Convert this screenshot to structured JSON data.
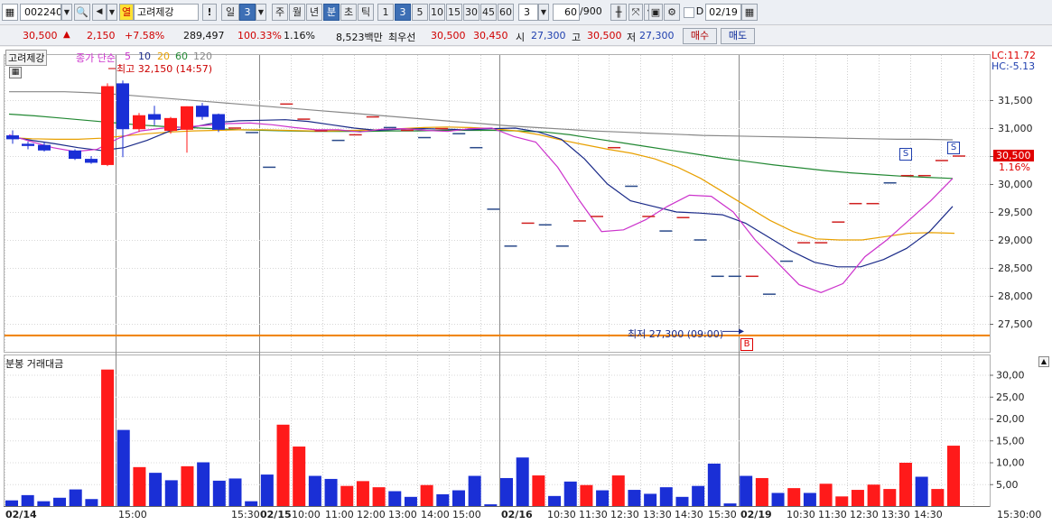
{
  "toolbar": {
    "code": "002240",
    "name": "고려제강",
    "exclaim": "!",
    "day_label": "일",
    "day_count": "3",
    "periods": [
      "주",
      "월",
      "년",
      "분",
      "초",
      "틱"
    ],
    "minutes": [
      "1",
      "3",
      "5",
      "10",
      "15",
      "30",
      "45",
      "60"
    ],
    "interval": "3",
    "count": "60",
    "total": "/900",
    "check_label": "D",
    "date": "02/19"
  },
  "quote": {
    "price": "30,500",
    "change": "2,150",
    "change_pct": "+7.58%",
    "volume": "289,497",
    "vol_ratio": "100.33%",
    "turnover": "1.16%",
    "amount": "8,523백만",
    "best_label": "최우선",
    "ask": "30,500",
    "bid": "30,450",
    "open_label": "시",
    "open": "27,300",
    "high_label": "고",
    "high": "30,500",
    "low_label": "저",
    "low": "27,300",
    "buy_button": "매수",
    "sell_button": "매도"
  },
  "legend": {
    "stock": "고려제강",
    "type": "종가 단순",
    "ma": [
      "5",
      "10",
      "20",
      "60",
      "120"
    ],
    "ma_colors": [
      "#cc33cc",
      "#1a2a88",
      "#e8a000",
      "#228833",
      "#888888"
    ],
    "high_marker": "최고 32,150 (14:57)",
    "low_marker": "최저 27,300 (09:00)",
    "lc": "LC:11.72",
    "hc": "HC:-5.13",
    "price_tag": "30,500",
    "pct_tag": "1.16%",
    "signal_s": "S",
    "signal_b": "B"
  },
  "lower_title": "분봉 거래대금",
  "chart_data": [
    {
      "type": "candlestick",
      "y_ticks": [
        "31,500",
        "31,000",
        "30,500",
        "30,000",
        "29,500",
        "29,000",
        "28,500",
        "28,000",
        "27,500"
      ],
      "candles": [
        {
          "open": 30870,
          "high": 30960,
          "low": 30720,
          "close": 30800,
          "color": "blue"
        },
        {
          "open": 30720,
          "high": 30760,
          "low": 30620,
          "close": 30680,
          "color": "blue"
        },
        {
          "open": 30700,
          "high": 30760,
          "low": 30580,
          "close": 30600,
          "color": "blue"
        },
        {
          "open": 30600,
          "high": 30620,
          "low": 30430,
          "close": 30450,
          "color": "blue"
        },
        {
          "open": 30450,
          "high": 30500,
          "low": 30360,
          "close": 30380,
          "color": "blue"
        },
        {
          "open": 30340,
          "high": 31800,
          "low": 30320,
          "close": 31750,
          "color": "red"
        },
        {
          "open": 31800,
          "high": 31850,
          "low": 30480,
          "close": 30980,
          "color": "blue"
        },
        {
          "open": 30980,
          "high": 31270,
          "low": 30930,
          "close": 31230,
          "color": "red"
        },
        {
          "open": 31250,
          "high": 31400,
          "low": 31050,
          "close": 31150,
          "color": "blue"
        },
        {
          "open": 30950,
          "high": 31200,
          "low": 30900,
          "close": 31180,
          "color": "red"
        },
        {
          "open": 30970,
          "high": 31390,
          "low": 30560,
          "close": 31390,
          "color": "red"
        },
        {
          "open": 31400,
          "high": 31450,
          "low": 31150,
          "close": 31200,
          "color": "blue"
        },
        {
          "open": 31250,
          "high": 31260,
          "low": 30930,
          "close": 30970,
          "color": "blue"
        }
      ],
      "flat_marks": [
        {
          "price": 31000,
          "color": "red"
        },
        {
          "price": 30920,
          "color": "blue"
        },
        {
          "price": 30300,
          "color": "blue"
        },
        {
          "price": 31430,
          "color": "red"
        },
        {
          "price": 31160,
          "color": "red"
        },
        {
          "price": 30950,
          "color": "red"
        },
        {
          "price": 30780,
          "color": "blue"
        },
        {
          "price": 30880,
          "color": "red"
        },
        {
          "price": 31200,
          "color": "red"
        },
        {
          "price": 31010,
          "color": "blue"
        },
        {
          "price": 30960,
          "color": "red"
        },
        {
          "price": 30830,
          "color": "blue"
        },
        {
          "price": 30990,
          "color": "red"
        },
        {
          "price": 30900,
          "color": "blue"
        },
        {
          "price": 30650,
          "color": "blue"
        },
        {
          "price": 29550,
          "color": "blue"
        },
        {
          "price": 28890,
          "color": "blue"
        },
        {
          "price": 29300,
          "color": "red"
        },
        {
          "price": 29270,
          "color": "blue"
        },
        {
          "price": 28890,
          "color": "blue"
        },
        {
          "price": 29340,
          "color": "red"
        },
        {
          "price": 29420,
          "color": "red"
        },
        {
          "price": 30650,
          "color": "red"
        },
        {
          "price": 29960,
          "color": "blue"
        },
        {
          "price": 29420,
          "color": "red"
        },
        {
          "price": 29160,
          "color": "blue"
        },
        {
          "price": 29400,
          "color": "red"
        },
        {
          "price": 29000,
          "color": "blue"
        },
        {
          "price": 28350,
          "color": "blue"
        },
        {
          "price": 28350,
          "color": "blue"
        },
        {
          "price": 28350,
          "color": "red"
        },
        {
          "price": 28030,
          "color": "blue"
        },
        {
          "price": 28620,
          "color": "blue"
        },
        {
          "price": 28950,
          "color": "red"
        },
        {
          "price": 28950,
          "color": "red"
        },
        {
          "price": 29320,
          "color": "red"
        },
        {
          "price": 29650,
          "color": "red"
        },
        {
          "price": 29650,
          "color": "red"
        },
        {
          "price": 30020,
          "color": "blue"
        },
        {
          "price": 30150,
          "color": "red"
        },
        {
          "price": 30150,
          "color": "red"
        },
        {
          "price": 30420,
          "color": "red"
        },
        {
          "price": 30500,
          "color": "red"
        }
      ],
      "ma5": [
        30880,
        30760,
        30650,
        30580,
        30620,
        30820,
        30950,
        31000,
        31020,
        31050,
        31080,
        31090,
        31060,
        31010,
        30970,
        30970,
        30930,
        30980,
        30990,
        30960,
        30940,
        30990,
        31000,
        30850,
        30750,
        30300,
        29700,
        29150,
        29180,
        29360,
        29600,
        29800,
        29780,
        29500,
        29000,
        28600,
        28200,
        28060,
        28220,
        28700,
        29000,
        29350,
        29700,
        30100
      ],
      "ma10": [
        30850,
        30780,
        30720,
        30650,
        30600,
        30650,
        30780,
        30950,
        31020,
        31100,
        31130,
        31140,
        31150,
        31120,
        31060,
        31000,
        30960,
        30980,
        30990,
        30980,
        30970,
        30990,
        31000,
        30930,
        30800,
        30450,
        30000,
        29700,
        29600,
        29500,
        29480,
        29450,
        29300,
        29050,
        28800,
        28600,
        28520,
        28520,
        28650,
        28850,
        29150,
        29600
      ],
      "ma20": [
        30830,
        30810,
        30800,
        30800,
        30820,
        30860,
        30900,
        30930,
        30950,
        30960,
        30970,
        30970,
        30960,
        30950,
        30950,
        30960,
        30970,
        30990,
        31010,
        31020,
        31010,
        30990,
        30950,
        30880,
        30780,
        30700,
        30620,
        30550,
        30450,
        30300,
        30100,
        29850,
        29600,
        29350,
        29150,
        29020,
        29000,
        29000,
        29060,
        29120,
        29130,
        29120
      ],
      "ma60": [
        31250,
        31220,
        31180,
        31140,
        31100,
        31060,
        31030,
        31010,
        30990,
        30970,
        30960,
        30950,
        30940,
        30940,
        30940,
        30950,
        30950,
        30960,
        30960,
        30960,
        30950,
        30930,
        30880,
        30810,
        30740,
        30670,
        30600,
        30530,
        30460,
        30400,
        30340,
        30290,
        30240,
        30200,
        30170,
        30140,
        30120,
        30100
      ],
      "ma120": [
        31650,
        31650,
        31650,
        31630,
        31600,
        31560,
        31520,
        31480,
        31440,
        31400,
        31360,
        31320,
        31280,
        31240,
        31200,
        31160,
        31120,
        31080,
        31040,
        31010,
        30980,
        30950,
        30930,
        30910,
        30890,
        30870,
        30860,
        30850,
        30840,
        30830,
        30820,
        30810,
        30800,
        30800,
        30790
      ]
    },
    {
      "type": "bar",
      "title": "분봉 거래대금",
      "y_ticks": [
        "30,00",
        "25,00",
        "20,00",
        "15,00",
        "10,00",
        "5,00"
      ],
      "x_ticks": [
        "02/14",
        "15:00",
        "15:30",
        "02/15",
        "10:00",
        "11:00",
        "12:00",
        "13:00",
        "14:00",
        "15:00",
        "02/16",
        "10:30",
        "11:30",
        "12:30",
        "13:30",
        "14:30",
        "15:30",
        "02/19",
        "10:30",
        "11:30",
        "12:30",
        "13:30",
        "14:30",
        "15:30:00"
      ],
      "values": [
        1.3,
        2.5,
        1.1,
        1.9,
        3.8,
        1.6,
        31.2,
        17.4,
        8.9,
        7.6,
        5.9,
        9.1,
        10.0,
        5.8,
        6.3,
        1.1,
        7.2,
        18.6,
        13.6,
        6.9,
        6.2,
        4.6,
        5.7,
        4.3,
        3.4,
        2.1,
        4.8,
        2.7,
        3.6,
        6.9,
        0.4,
        6.4,
        11.1,
        7.0,
        2.3,
        5.6,
        4.8,
        3.6,
        7.0,
        3.7,
        2.8,
        4.3,
        2.1,
        4.6,
        9.7,
        0.6,
        6.9,
        6.4,
        3.0,
        4.1,
        3.0,
        5.1,
        2.2,
        3.7,
        4.9,
        3.9,
        9.9,
        6.7,
        3.9,
        13.8
      ],
      "colors": [
        "blue",
        "blue",
        "blue",
        "blue",
        "blue",
        "blue",
        "red",
        "blue",
        "red",
        "blue",
        "blue",
        "red",
        "blue",
        "blue",
        "blue",
        "blue",
        "blue",
        "red",
        "red",
        "blue",
        "blue",
        "red",
        "red",
        "red",
        "blue",
        "blue",
        "red",
        "blue",
        "blue",
        "blue",
        "blue",
        "blue",
        "blue",
        "red",
        "blue",
        "blue",
        "red",
        "blue",
        "red",
        "blue",
        "blue",
        "blue",
        "blue",
        "blue",
        "blue",
        "blue",
        "blue",
        "red",
        "blue",
        "red",
        "blue",
        "red",
        "red",
        "red",
        "red",
        "red",
        "red",
        "blue",
        "red",
        "red"
      ]
    }
  ]
}
